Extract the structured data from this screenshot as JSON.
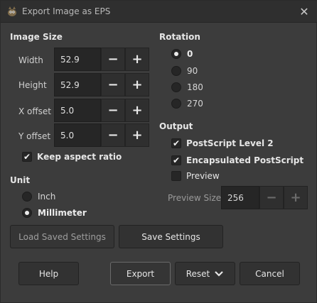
{
  "window": {
    "title": "Export Image as EPS"
  },
  "image_size": {
    "title": "Image Size",
    "rows": [
      {
        "label": "Width",
        "value": "52.9"
      },
      {
        "label": "Height",
        "value": "52.9"
      },
      {
        "label": "X offset",
        "value": "5.0"
      },
      {
        "label": "Y offset",
        "value": "5.0"
      }
    ],
    "keep_aspect": {
      "label": "Keep aspect ratio",
      "checked": true
    }
  },
  "unit": {
    "title": "Unit",
    "options": [
      {
        "label": "Inch",
        "selected": false
      },
      {
        "label": "Millimeter",
        "selected": true
      }
    ]
  },
  "rotation": {
    "title": "Rotation",
    "options": [
      {
        "label": "0",
        "selected": true
      },
      {
        "label": "90",
        "selected": false
      },
      {
        "label": "180",
        "selected": false
      },
      {
        "label": "270",
        "selected": false
      }
    ]
  },
  "output": {
    "title": "Output",
    "options": [
      {
        "label": "PostScript Level 2",
        "checked": true
      },
      {
        "label": "Encapsulated PostScript",
        "checked": true
      },
      {
        "label": "Preview",
        "checked": false
      }
    ],
    "preview_size": {
      "label": "Preview Size",
      "value": "256"
    }
  },
  "buttons": {
    "load_saved": "Load Saved Settings",
    "save_settings": "Save Settings",
    "help": "Help",
    "export": "Export",
    "reset": "Reset",
    "cancel": "Cancel"
  },
  "symbols": {
    "minus": "−",
    "plus": "+",
    "check": "✔",
    "close": "✕",
    "chevron": "⌄"
  }
}
